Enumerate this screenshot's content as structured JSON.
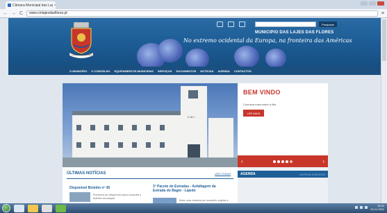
{
  "browser": {
    "tab_title": "Câmara Municipal das Laj",
    "tab_close": "×",
    "url": "www.cmlajesdasflores.pt",
    "back": "←",
    "forward": "→",
    "reload": "C",
    "wrench": "≡"
  },
  "header": {
    "municipality": "MUNICIPIO DAS LAJES DAS FLORES",
    "slogan": "No extremo ocidental da Europa, na fronteira das Américas",
    "search_placeholder": "",
    "search_button": "Pesquisar",
    "crest_banner": "LAJES DAS FLORES"
  },
  "menu": {
    "items": [
      {
        "label": "O MUNICÍPIO"
      },
      {
        "label": "O CONCELHO"
      },
      {
        "label": "EQUIPAMENTOS MUNICIPAIS"
      },
      {
        "label": "SERVIÇOS"
      },
      {
        "label": "DOCUMENTOS"
      },
      {
        "label": "NOTÍCIAS"
      },
      {
        "label": "AGENDA"
      },
      {
        "label": "CONTACTOS"
      }
    ]
  },
  "welcome": {
    "title": "BEM VINDO",
    "subtitle": "Conheça mais sobre a ilha",
    "button": "LER MAIS"
  },
  "slider": {
    "prev": "‹",
    "next": "›"
  },
  "photo": {
    "building_sign": "C M L"
  },
  "news": {
    "title": "ÚLTIMAS NOTÍCIAS",
    "see_all": "VER TODAS",
    "articles": [
      {
        "title": "Disponível Boletim nº 45",
        "summary": "Encontra-se disponível para consulta o boletim municipal"
      },
      {
        "title": "3º Pacote de Estradas - Asfaltagem da Estrada do Bagio - Lajedo",
        "summary": "Mais uma estrada do concelho sujeita a trabalhos de asfaltagem"
      }
    ]
  },
  "agenda": {
    "title": "AGENDA",
    "other_events": "OUTROS EVENTOS"
  },
  "taskbar": {
    "time": "15:41",
    "date": "23-11-2011"
  },
  "colors": {
    "header_blue": "#1e5f97",
    "menu_blue": "#1a4f80",
    "accent_red": "#c8362a"
  }
}
